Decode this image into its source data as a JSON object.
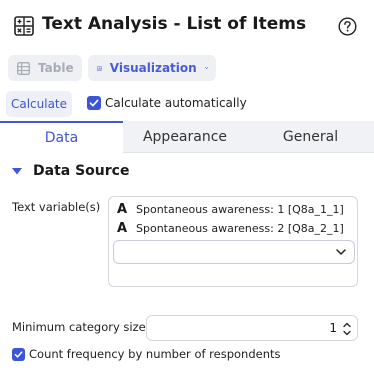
{
  "header": {
    "title": "Text Analysis - List of Items",
    "app_icon": "calculator-icon",
    "help_icon": "help-icon"
  },
  "toolbar": {
    "table_label": "Table",
    "visualization_label": "Visualization",
    "table_icon": "table-icon",
    "visualization_icon": "chart-icon"
  },
  "calculate": {
    "button_label": "Calculate",
    "auto_label": "Calculate automatically",
    "auto_checked": true
  },
  "tabs": [
    {
      "label": "Data",
      "active": true
    },
    {
      "label": "Appearance",
      "active": false
    },
    {
      "label": "General",
      "active": false
    }
  ],
  "section": {
    "title": "Data Source"
  },
  "text_variables": {
    "label": "Text variable(s)",
    "items": [
      {
        "type_glyph": "A",
        "label": "Spontaneous awareness: 1 [Q8a_1_1]"
      },
      {
        "type_glyph": "A",
        "label": "Spontaneous awareness: 2 [Q8a_2_1]"
      }
    ],
    "selector_value": ""
  },
  "min_category": {
    "label": "Minimum category size",
    "value": "1"
  },
  "count_frequency": {
    "label": "Count frequency by number of respondents",
    "checked": true
  },
  "colors": {
    "accent": "#3f56d6",
    "tab_inactive_bg": "#f1f2f5",
    "toolbar_bg": "#eef0f4",
    "disabled_text": "#a8acb6"
  }
}
